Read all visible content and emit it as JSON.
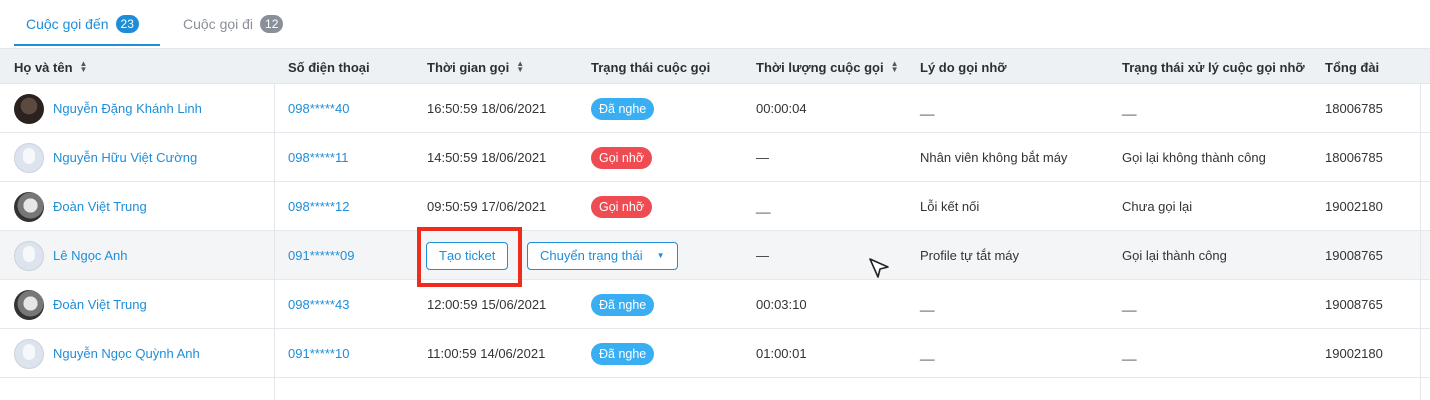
{
  "tabs": [
    {
      "label": "Cuộc gọi đến",
      "count": "23"
    },
    {
      "label": "Cuộc gọi đi",
      "count": "12"
    }
  ],
  "columns": {
    "name": "Họ và tên",
    "phone": "Số điện thoại",
    "time": "Thời gian gọi",
    "status": "Trạng thái cuộc gọi",
    "duration": "Thời lượng cuộc gọi",
    "reason": "Lý do gọi nhỡ",
    "handle": "Trạng thái xử lý cuộc gọi nhỡ",
    "switchboard": "Tổng đài"
  },
  "rows": [
    {
      "name": "Nguyễn Đặng Khánh Linh",
      "phone": "098*****40",
      "time": "16:50:59 18/06/2021",
      "status": "Đã nghe",
      "duration": "00:00:04",
      "reason": "__",
      "handle": "__",
      "switchboard": "18006785"
    },
    {
      "name": "Nguyễn Hữu Việt Cường",
      "phone": "098*****11",
      "time": "14:50:59 18/06/2021",
      "status": "Gọi nhỡ",
      "duration": "—",
      "reason": "Nhân viên không bắt máy",
      "handle": "Gọi lại không thành công",
      "switchboard": "18006785"
    },
    {
      "name": "Đoàn Việt Trung",
      "phone": "098*****12",
      "time": "09:50:59 17/06/2021",
      "status": "Gọi nhỡ",
      "duration": "__",
      "reason": "Lỗi kết nối",
      "handle": "Chưa gọi lại",
      "switchboard": "19002180"
    },
    {
      "name": "Lê Ngọc Anh",
      "phone": "091******09",
      "time": "",
      "status": "",
      "duration": "—",
      "reason": "Profile tự tắt máy",
      "handle": "Gọi lại thành công",
      "switchboard": "19008765"
    },
    {
      "name": "Đoàn Việt Trung",
      "phone": "098*****43",
      "time": "12:00:59 15/06/2021",
      "status": "Đã nghe",
      "duration": "00:03:10",
      "reason": "__",
      "handle": "__",
      "switchboard": "19008765"
    },
    {
      "name": "Nguyễn Ngọc Quỳnh Anh",
      "phone": "091*****10",
      "time": "11:00:59 14/06/2021",
      "status": "Đã nghe",
      "duration": "01:00:01",
      "reason": "__",
      "handle": "__",
      "switchboard": "19002180"
    }
  ],
  "row_actions": {
    "create_ticket": "Tạo ticket",
    "change_status": "Chuyển trạng thái"
  },
  "colors": {
    "accent": "#1f8ed8",
    "answered": "#3aaef2",
    "missed": "#ef4b52",
    "highlight": "#ee2b1d"
  }
}
